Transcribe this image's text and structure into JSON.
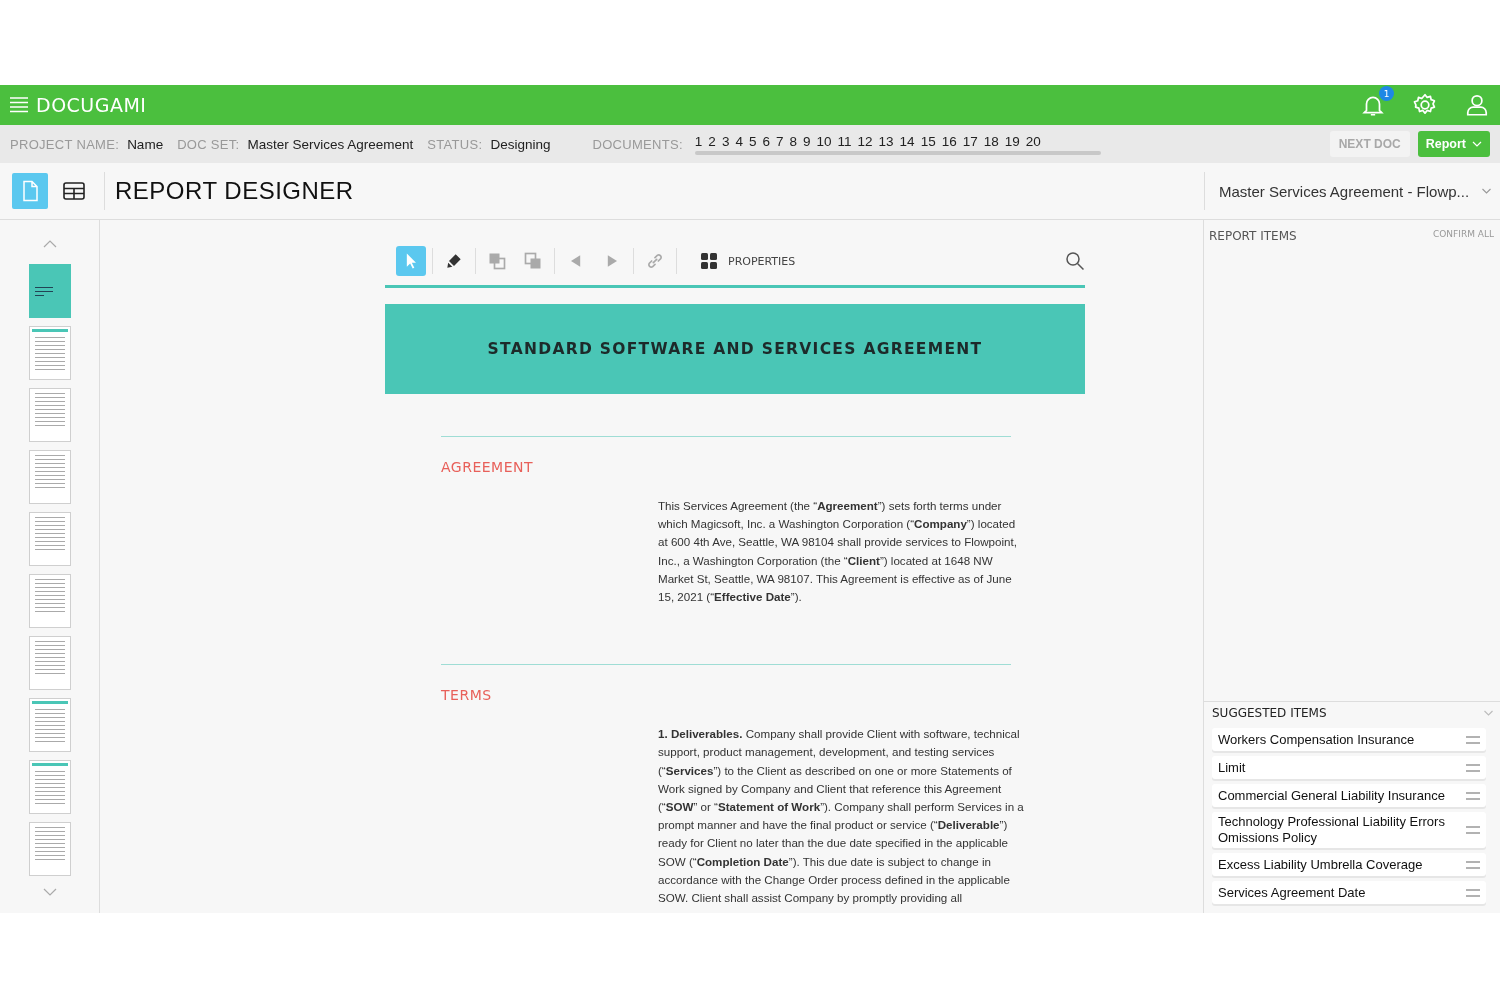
{
  "app": {
    "brand": "DOCUGAMI",
    "notification_count": "1"
  },
  "info_bar": {
    "fields": [
      {
        "label": "PROJECT NAME:",
        "value": "Name"
      },
      {
        "label": "DOC SET:",
        "value": "Master Services Agreement"
      },
      {
        "label": "STATUS:",
        "value": "Designing"
      }
    ],
    "documents_label": "DOCUMENTS:",
    "documents": [
      "1",
      "2",
      "3",
      "4",
      "5",
      "6",
      "7",
      "8",
      "9",
      "10",
      "11",
      "12",
      "13",
      "14",
      "15",
      "16",
      "17",
      "18",
      "19",
      "20"
    ],
    "next_doc": {
      "label": "NEXT DOC",
      "disabled": true
    },
    "report_button": "Report"
  },
  "header": {
    "views": [
      {
        "kind": "document",
        "selected": true
      },
      {
        "kind": "table",
        "selected": false
      }
    ],
    "title": "REPORT DESIGNER",
    "document_select": "Master Services Agreement - Flowp..."
  },
  "thumbnails": [
    {
      "kind": "cover"
    },
    {
      "kind": "text-header"
    },
    {
      "kind": "text"
    },
    {
      "kind": "text"
    },
    {
      "kind": "text"
    },
    {
      "kind": "text"
    },
    {
      "kind": "text"
    },
    {
      "kind": "text-header"
    },
    {
      "kind": "text-header"
    },
    {
      "kind": "text"
    }
  ],
  "toolbar": {
    "tools": [
      {
        "kind": "pointer",
        "selected": true,
        "disabled": false
      },
      {
        "kind": "highlighter",
        "selected": false,
        "disabled": false
      },
      {
        "kind": "bring-forward",
        "selected": false,
        "disabled": true
      },
      {
        "kind": "send-back",
        "selected": false,
        "disabled": true
      },
      {
        "kind": "previous",
        "selected": false,
        "disabled": true
      },
      {
        "kind": "next",
        "selected": false,
        "disabled": true
      },
      {
        "kind": "link",
        "selected": false,
        "disabled": true
      }
    ],
    "properties_label": "PROPERTIES"
  },
  "document": {
    "banner": "STANDARD SOFTWARE AND SERVICES AGREEMENT",
    "sections": [
      {
        "heading": "AGREEMENT",
        "paragraph": "This Services Agreement (the “**Agreement**”) sets forth terms under which Magicsoft, Inc. a Washington Corporation (“**Company**”) located at 600 4th Ave, Seattle, WA 98104 shall provide services to Flowpoint, Inc., a Washington Corporation (the “**Client**”) located at 1648 NW Market St, Seattle, WA 98107. This Agreement is effective as of June 15, 2021 (“**Effective Date**”)."
      },
      {
        "heading": "TERMS",
        "paragraph": "**1. Deliverables.** Company shall provide Client with software, technical support, product management, development, and testing services (“**Services**”) to the Client as described on one or more Statements of Work signed by Company and Client that reference this Agreement (“**SOW**” or “**Statement of Work**”). Company shall perform Services in a prompt manner and have the final product or service (“**Deliverable**”) ready for Client no later than the due date specified in the applicable SOW (“**Completion Date**”). This due date is subject to change in accordance with the Change Order process defined in the applicable SOW. Client shall assist Company by promptly providing all"
      }
    ]
  },
  "report_items": {
    "title": "REPORT ITEMS",
    "confirm_all": "CONFIRM ALL"
  },
  "suggested_items": {
    "title": "SUGGESTED ITEMS",
    "items": [
      "Workers Compensation Insurance",
      "Limit",
      "Commercial General Liability Insurance",
      "Technology Professional Liability Errors Omissions Policy",
      "Excess Liability Umbrella Coverage",
      "Services Agreement Date"
    ]
  }
}
